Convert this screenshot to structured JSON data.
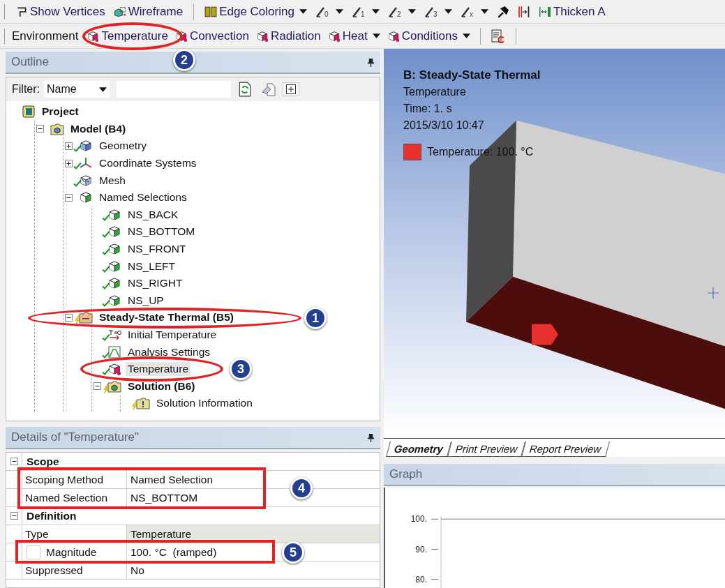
{
  "toolbar_top": {
    "items": [
      {
        "kind": "vertices",
        "label": "Show Vertices"
      },
      {
        "kind": "wireframe",
        "label": "Wireframe"
      },
      {
        "kind": "separator"
      },
      {
        "kind": "edge-coloring",
        "label": "Edge Coloring",
        "dropdown": true
      },
      {
        "kind": "edge-tool",
        "subscript": "0",
        "dropdown": true
      },
      {
        "kind": "edge-tool",
        "subscript": "1",
        "dropdown": true
      },
      {
        "kind": "edge-tool",
        "subscript": "2",
        "dropdown": true
      },
      {
        "kind": "edge-tool",
        "subscript": "3",
        "dropdown": true
      },
      {
        "kind": "edge-tool",
        "subscript": "x",
        "dropdown": true
      },
      {
        "kind": "pin"
      },
      {
        "kind": "split"
      },
      {
        "kind": "thicken",
        "label": "Thicken A"
      }
    ]
  },
  "toolbar_environment": {
    "label": "Environment",
    "items": [
      {
        "kind": "load",
        "label": "Temperature"
      },
      {
        "kind": "load",
        "label": "Convection"
      },
      {
        "kind": "load",
        "label": "Radiation"
      },
      {
        "kind": "load",
        "label": "Heat",
        "dropdown": true
      },
      {
        "kind": "load",
        "label": "Conditions",
        "dropdown": true
      },
      {
        "kind": "separator"
      },
      {
        "kind": "commands",
        "glyph": "C"
      }
    ]
  },
  "outline": {
    "title": "Outline",
    "filter": {
      "label": "Filter:",
      "mode": "Name"
    },
    "tree": [
      {
        "label": "Project",
        "kind": "project",
        "bold": true,
        "selected": false,
        "children": [
          {
            "label": "Model (B4)",
            "kind": "model",
            "bold": true,
            "expanded": true,
            "selected": false,
            "children": [
              {
                "label": "Geometry",
                "kind": "geometry",
                "solved": true,
                "expanded": false,
                "selected": false
              },
              {
                "label": "Coordinate Systems",
                "kind": "coords",
                "solved": true,
                "expanded": false,
                "selected": false
              },
              {
                "label": "Mesh",
                "kind": "mesh",
                "solved": true,
                "selected": false
              },
              {
                "label": "Named Selections",
                "kind": "named-selections",
                "expanded": true,
                "selected": false,
                "children": [
                  {
                    "label": "NS_BACK",
                    "kind": "named-selection",
                    "solved": true,
                    "selected": false
                  },
                  {
                    "label": "NS_BOTTOM",
                    "kind": "named-selection",
                    "solved": true,
                    "selected": false
                  },
                  {
                    "label": "NS_FRONT",
                    "kind": "named-selection",
                    "solved": true,
                    "selected": false
                  },
                  {
                    "label": "NS_LEFT",
                    "kind": "named-selection",
                    "solved": true,
                    "selected": false
                  },
                  {
                    "label": "NS_RIGHT",
                    "kind": "named-selection",
                    "solved": true,
                    "selected": false
                  },
                  {
                    "label": "NS_UP",
                    "kind": "named-selection",
                    "solved": true,
                    "selected": false
                  }
                ]
              },
              {
                "label": "Steady-State Thermal (B5)",
                "kind": "analysis",
                "bold": true,
                "solved": false,
                "expanded": true,
                "selected": false,
                "children": [
                  {
                    "label": "Initial Temperature",
                    "kind": "initial-temperature",
                    "solved": true,
                    "selected": false
                  },
                  {
                    "label": "Analysis Settings",
                    "kind": "settings",
                    "solved": true,
                    "selected": false
                  },
                  {
                    "label": "Temperature",
                    "kind": "load",
                    "solved": true,
                    "selected": true
                  },
                  {
                    "label": "Solution (B6)",
                    "kind": "solution",
                    "bold": true,
                    "solved": false,
                    "expanded": true,
                    "selected": false,
                    "children": [
                      {
                        "label": "Solution Information",
                        "kind": "solution-info",
                        "solved": false,
                        "selected": false
                      }
                    ]
                  }
                ]
              }
            ]
          }
        ]
      }
    ]
  },
  "details": {
    "title": "Details of \"Temperature\"",
    "sections": [
      {
        "title": "Scope",
        "expanded": true,
        "rows": [
          {
            "label": "Scoping Method",
            "value": "Named Selection",
            "readonly": false
          },
          {
            "label": "Named Selection",
            "value": "NS_BOTTOM",
            "readonly": false
          }
        ]
      },
      {
        "title": "Definition",
        "expanded": true,
        "rows": [
          {
            "label": "Type",
            "value": "Temperature",
            "readonly": true
          },
          {
            "label": "Magnitude",
            "value": "100. °C  (ramped)",
            "readonly": false,
            "checked": false
          },
          {
            "label": "Suppressed",
            "value": "No",
            "readonly": false
          }
        ]
      }
    ]
  },
  "viewport": {
    "title": "B: Steady-State Thermal",
    "lines": [
      "Temperature",
      "Time: 1. s",
      "2015/3/10 10:47"
    ],
    "legend": [
      {
        "label": "Temperature: 100. °C",
        "color": "#e8312f"
      }
    ],
    "tabs": [
      {
        "label": "Geometry",
        "selected": true
      },
      {
        "label": "Print Preview",
        "selected": false
      },
      {
        "label": "Report Preview",
        "selected": false
      }
    ]
  },
  "graph": {
    "title": "Graph",
    "y_tick_labels": [
      "100.",
      "90.",
      "80."
    ]
  },
  "callouts": [
    {
      "number": "1",
      "kind": "ellipse"
    },
    {
      "number": "2",
      "kind": "ellipse"
    },
    {
      "number": "3",
      "kind": "ellipse"
    },
    {
      "number": "4",
      "kind": "rect"
    },
    {
      "number": "5",
      "kind": "rect"
    }
  ]
}
